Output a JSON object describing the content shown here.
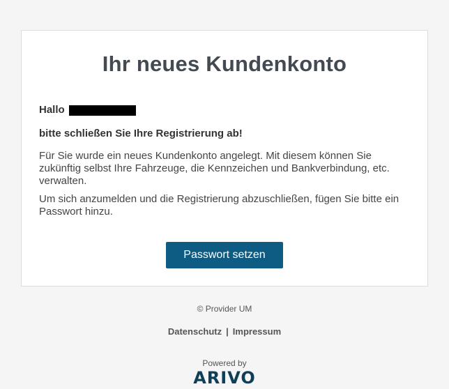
{
  "card": {
    "title": "Ihr neues Kundenkonto",
    "greeting": "Hallo",
    "subheading": "bitte schließen Sie Ihre Registrierung ab!",
    "paragraph1": "Für Sie wurde ein neues Kundenkonto angelegt. Mit diesem können Sie zukünftig selbst Ihre Fahrzeuge, die Kennzeichen und Bankverbindung, etc. verwalten.",
    "paragraph2": "Um sich anzumelden und die Registrierung abzuschließen, fügen Sie bitte ein Passwort hinzu.",
    "button_label": "Passwort setzen"
  },
  "footer": {
    "copyright": "© Provider UM",
    "link_privacy": "Datenschutz",
    "separator": "|",
    "link_imprint": "Impressum",
    "powered_by": "Powered by",
    "logo_text": "ARIVO"
  },
  "colors": {
    "button_bg": "#0e5b84",
    "logo": "#0f3e57",
    "page_bg": "#f5f5f5"
  }
}
